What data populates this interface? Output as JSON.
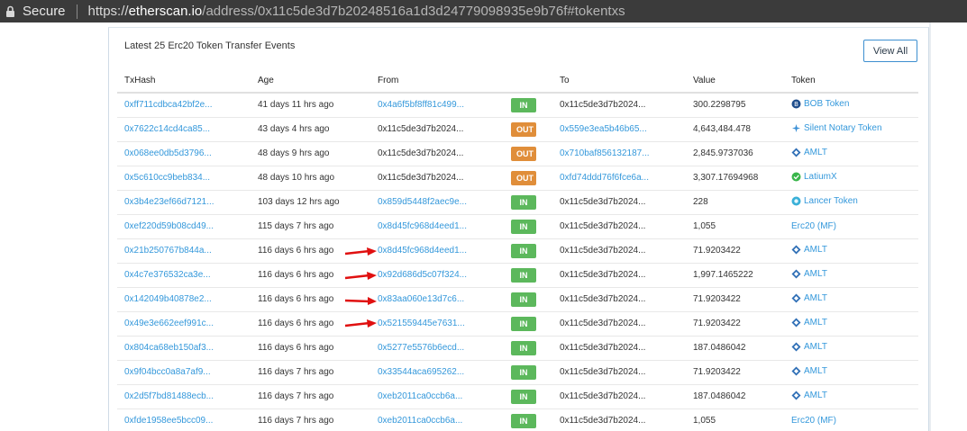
{
  "browser": {
    "secure_label": "Secure",
    "url_scheme": "https://",
    "url_host": "etherscan.io",
    "url_path": "/address/0x11c5de3d7b20248516a1d3d24779098935e9b76f#tokentxs"
  },
  "panel": {
    "title": "Latest 25 Erc20 Token Transfer Events",
    "view_all_label": "View All"
  },
  "table": {
    "headers": [
      "TxHash",
      "Age",
      "From",
      "",
      "To",
      "Value",
      "Token"
    ],
    "rows": [
      {
        "hash": "0xff711cdbca42bf2e...",
        "age": "41 days 11 hrs ago",
        "from": "0x4a6f5bf8ff81c499...",
        "from_link": true,
        "dir": "IN",
        "to": "0x11c5de3d7b2024...",
        "to_link": false,
        "value": "300.2298795",
        "token": "BOB Token",
        "token_icon": "bob-token-icon"
      },
      {
        "hash": "0x7622c14cd4ca85...",
        "age": "43 days 4 hrs ago",
        "from": "0x11c5de3d7b2024...",
        "from_link": false,
        "dir": "OUT",
        "to": "0x559e3ea5b46b65...",
        "to_link": true,
        "value": "4,643,484.478",
        "token": "Silent Notary Token",
        "token_icon": "silent-notary-icon"
      },
      {
        "hash": "0x068ee0db5d3796...",
        "age": "48 days 9 hrs ago",
        "from": "0x11c5de3d7b2024...",
        "from_link": false,
        "dir": "OUT",
        "to": "0x710baf856132187...",
        "to_link": true,
        "value": "2,845.9737036",
        "token": "AMLT",
        "token_icon": "amlt-icon"
      },
      {
        "hash": "0x5c610cc9beb834...",
        "age": "48 days 10 hrs ago",
        "from": "0x11c5de3d7b2024...",
        "from_link": false,
        "dir": "OUT",
        "to": "0xfd74ddd76f6fce6a...",
        "to_link": true,
        "value": "3,307.17694968",
        "token": "LatiumX",
        "token_icon": "latiumx-icon"
      },
      {
        "hash": "0x3b4e23ef66d7121...",
        "age": "103 days 12 hrs ago",
        "from": "0x859d5448f2aec9e...",
        "from_link": true,
        "dir": "IN",
        "to": "0x11c5de3d7b2024...",
        "to_link": false,
        "value": "228",
        "token": "Lancer Token",
        "token_icon": "lancer-token-icon"
      },
      {
        "hash": "0xef220d59b08cd49...",
        "age": "115 days 7 hrs ago",
        "from": "0x8d45fc968d4eed1...",
        "from_link": true,
        "dir": "IN",
        "to": "0x11c5de3d7b2024...",
        "to_link": false,
        "value": "1,055",
        "token": "Erc20 (MF)",
        "token_icon": ""
      },
      {
        "hash": "0x21b250767b844a...",
        "age": "116 days 6 hrs ago",
        "from": "0x8d45fc968d4eed1...",
        "from_link": true,
        "dir": "IN",
        "to": "0x11c5de3d7b2024...",
        "to_link": false,
        "value": "71.9203422",
        "token": "AMLT",
        "token_icon": "amlt-icon"
      },
      {
        "hash": "0x4c7e376532ca3e...",
        "age": "116 days 6 hrs ago",
        "from": "0x92d686d5c07f324...",
        "from_link": true,
        "dir": "IN",
        "to": "0x11c5de3d7b2024...",
        "to_link": false,
        "value": "1,997.1465222",
        "token": "AMLT",
        "token_icon": "amlt-icon"
      },
      {
        "hash": "0x142049b40878e2...",
        "age": "116 days 6 hrs ago",
        "from": "0x83aa060e13d7c6...",
        "from_link": true,
        "dir": "IN",
        "to": "0x11c5de3d7b2024...",
        "to_link": false,
        "value": "71.9203422",
        "token": "AMLT",
        "token_icon": "amlt-icon"
      },
      {
        "hash": "0x49e3e662eef991c...",
        "age": "116 days 6 hrs ago",
        "from": "0x521559445e7631...",
        "from_link": true,
        "dir": "IN",
        "to": "0x11c5de3d7b2024...",
        "to_link": false,
        "value": "71.9203422",
        "token": "AMLT",
        "token_icon": "amlt-icon"
      },
      {
        "hash": "0x804ca68eb150af3...",
        "age": "116 days 6 hrs ago",
        "from": "0x5277e5576b6ecd...",
        "from_link": true,
        "dir": "IN",
        "to": "0x11c5de3d7b2024...",
        "to_link": false,
        "value": "187.0486042",
        "token": "AMLT",
        "token_icon": "amlt-icon"
      },
      {
        "hash": "0x9f04bcc0a8a7af9...",
        "age": "116 days 7 hrs ago",
        "from": "0x33544aca695262...",
        "from_link": true,
        "dir": "IN",
        "to": "0x11c5de3d7b2024...",
        "to_link": false,
        "value": "71.9203422",
        "token": "AMLT",
        "token_icon": "amlt-icon"
      },
      {
        "hash": "0x2d5f7bd81488ecb...",
        "age": "116 days 7 hrs ago",
        "from": "0xeb2011ca0ccb6a...",
        "from_link": true,
        "dir": "IN",
        "to": "0x11c5de3d7b2024...",
        "to_link": false,
        "value": "187.0486042",
        "token": "AMLT",
        "token_icon": "amlt-icon"
      },
      {
        "hash": "0xfde1958ee5bcc09...",
        "age": "116 days 7 hrs ago",
        "from": "0xeb2011ca0ccb6a...",
        "from_link": true,
        "dir": "IN",
        "to": "0x11c5de3d7b2024...",
        "to_link": false,
        "value": "1,055",
        "token": "Erc20 (MF)",
        "token_icon": ""
      }
    ]
  },
  "colors": {
    "link": "#3498db",
    "badge_in": "#5cb85c",
    "badge_out": "#e08e3a",
    "annotation_arrow": "#e01010"
  }
}
